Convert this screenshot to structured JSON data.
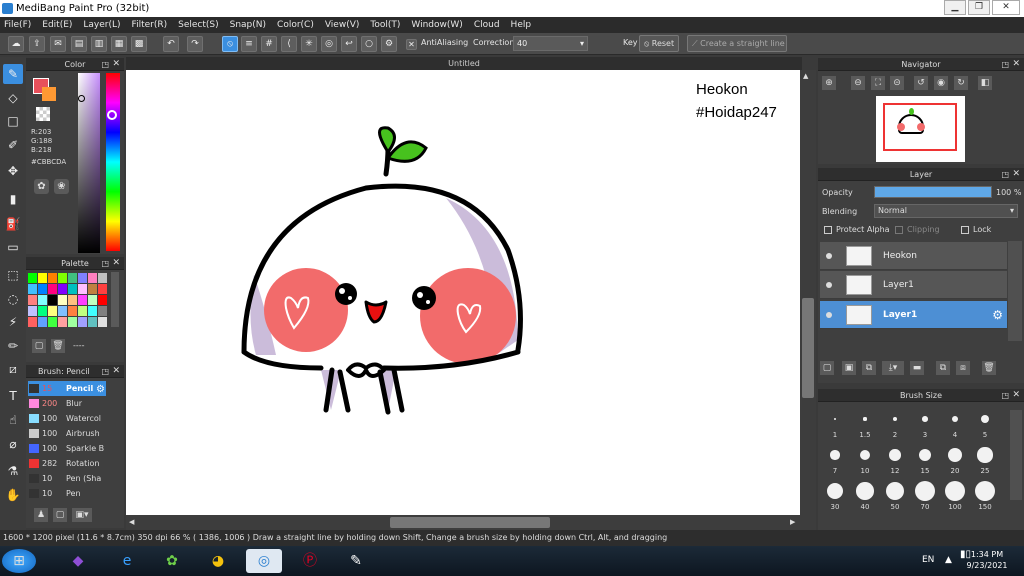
{
  "window": {
    "title": "MediBang Paint Pro (32bit)"
  },
  "menu": [
    "File(F)",
    "Edit(E)",
    "Layer(L)",
    "Filter(R)",
    "Select(S)",
    "Snap(N)",
    "Color(C)",
    "View(V)",
    "Tool(T)",
    "Window(W)",
    "Cloud",
    "Help"
  ],
  "toolbar": {
    "antialiasing_label": "AntiAliasing",
    "correction_label": "Correction",
    "correction_value": "40",
    "key_label": "Key",
    "reset_label": "Reset",
    "straight_line_label": "Create a straight line"
  },
  "color_panel": {
    "title": "Color",
    "r": "R:203",
    "g": "G:188",
    "b": "B:218",
    "hex": "#CBBCDA",
    "primary": "#e8505b",
    "secondary": "#ff9933"
  },
  "palette_panel": {
    "title": "Palette",
    "swatches": [
      "#00ff00",
      "#ffff00",
      "#ff8000",
      "#80ff00",
      "#40c080",
      "#8080ff",
      "#ff80c0",
      "#c0c0c0",
      "#40c0ff",
      "#0080ff",
      "#ff0080",
      "#8000ff",
      "#00c0c0",
      "#ffc0ff",
      "#c08040",
      "#ff4040",
      "#ff8080",
      "#80ffff",
      "#000000",
      "#ffffc0",
      "#ffc080",
      "#ff40ff",
      "#c0ffc0",
      "#ff0000",
      "#c0c0ff",
      "#00ff80",
      "#ffff80",
      "#80c0ff",
      "#ff8040",
      "#c0ff80",
      "#40ffff",
      "#808080",
      "#ff6060",
      "#60a0ff",
      "#40ff40",
      "#ffa0a0",
      "#a0ffa0",
      "#a0a0ff",
      "#60c0c0",
      "#e0e0e0"
    ],
    "dash": "----"
  },
  "brush_panel": {
    "title": "Brush: Pencil",
    "items": [
      {
        "size": "15",
        "name": "Pencil",
        "color": "#333333"
      },
      {
        "size": "200",
        "name": "Blur",
        "color": "#ff88dd"
      },
      {
        "size": "100",
        "name": "Watercol",
        "color": "#88ddff"
      },
      {
        "size": "100",
        "name": "Airbrush",
        "color": "#cccccc"
      },
      {
        "size": "100",
        "name": "Sparkle B",
        "color": "#4466ff"
      },
      {
        "size": "282",
        "name": "Rotation",
        "color": "#ee3333"
      },
      {
        "size": "10",
        "name": "Pen (Sha",
        "color": "#333333"
      },
      {
        "size": "10",
        "name": "Pen",
        "color": "#333333"
      }
    ]
  },
  "document": {
    "tab": "Untitled",
    "watermark_line1": "Heokon",
    "watermark_line2": "#Hoidap247"
  },
  "navigator": {
    "title": "Navigator"
  },
  "layer_panel": {
    "title": "Layer",
    "opacity_label": "Opacity",
    "opacity_value": "100 %",
    "opacity_fraction": 1.0,
    "blending_label": "Blending",
    "blending_value": "Normal",
    "protect_alpha": "Protect Alpha",
    "clipping": "Clipping",
    "lock": "Lock",
    "layers": [
      {
        "name": "Heokon",
        "selected": false
      },
      {
        "name": "Layer1",
        "selected": false
      },
      {
        "name": "Layer1",
        "selected": true
      }
    ]
  },
  "brush_size_panel": {
    "title": "Brush Size",
    "sizes": [
      "1",
      "1.5",
      "2",
      "3",
      "4",
      "5",
      "7",
      "10",
      "12",
      "15",
      "20",
      "25",
      "30",
      "40",
      "50",
      "70",
      "100",
      "150"
    ]
  },
  "status": {
    "text": "1600 * 1200 pixel  (11.6 * 8.7cm)  350 dpi  66 %  ( 1386, 1006 )  Draw a straight line by holding down Shift, Change a brush size by holding down Ctrl, Alt, and dragging"
  },
  "taskbar": {
    "lang": "EN",
    "time": "1:34 PM",
    "date": "9/23/2021"
  },
  "colors": {
    "accent": "#3b8fe0",
    "blush": "#f26b6b",
    "stem": "#47c21e",
    "shadow": "#cbbcda"
  }
}
